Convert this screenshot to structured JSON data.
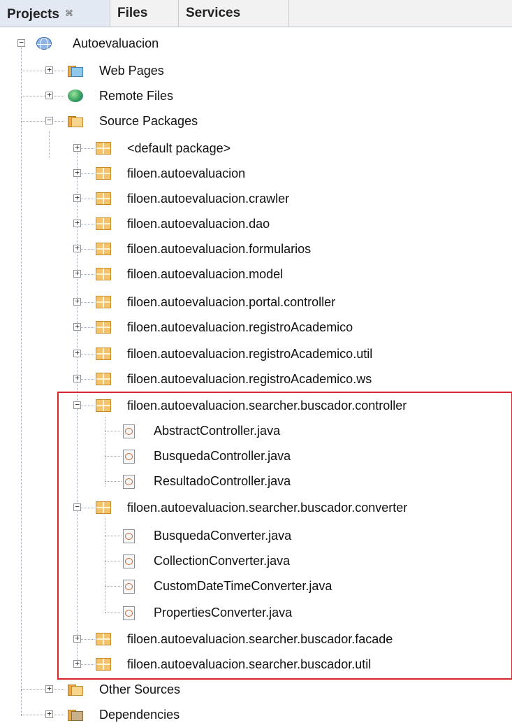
{
  "tabs": [
    {
      "label": "Projects",
      "close": "⌘",
      "active": true
    },
    {
      "label": "Files",
      "active": false
    },
    {
      "label": "Services",
      "active": false
    }
  ],
  "tree": {
    "project": "Autoevaluacion",
    "web_pages": "Web Pages",
    "remote_files": "Remote Files",
    "source_packages": "Source Packages",
    "packages": [
      "<default package>",
      "filoen.autoevaluacion",
      "filoen.autoevaluacion.crawler",
      "filoen.autoevaluacion.dao",
      "filoen.autoevaluacion.formularios",
      "filoen.autoevaluacion.model",
      "filoen.autoevaluacion.portal.controller",
      "filoen.autoevaluacion.registroAcademico",
      "filoen.autoevaluacion.registroAcademico.util",
      "filoen.autoevaluacion.registroAcademico.ws"
    ],
    "controller_package": "filoen.autoevaluacion.searcher.buscador.controller",
    "controller_files": [
      "AbstractController.java",
      "BusquedaController.java",
      "ResultadoController.java"
    ],
    "converter_package": "filoen.autoevaluacion.searcher.buscador.converter",
    "converter_files": [
      "BusquedaConverter.java",
      "CollectionConverter.java",
      "CustomDateTimeConverter.java",
      "PropertiesConverter.java"
    ],
    "facade_package": "filoen.autoevaluacion.searcher.buscador.facade",
    "util_package": "filoen.autoevaluacion.searcher.buscador.util",
    "other_sources": "Other Sources",
    "dependencies": "Dependencies"
  },
  "colors": {
    "highlight": "#d8262e",
    "package": "#f4c36c",
    "folder": "#e9a949"
  }
}
